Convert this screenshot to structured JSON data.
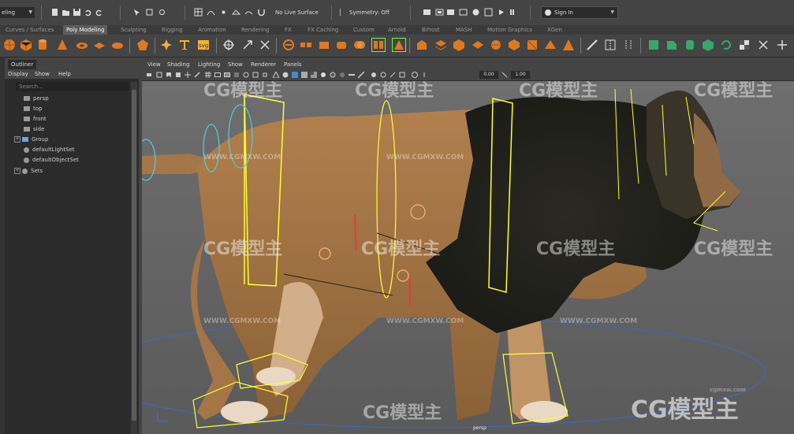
{
  "status_line": {
    "mode_menu": "eling",
    "live_surface": "No Live Surface",
    "symmetry": "Symmetry: Off",
    "sign_in": "Sign In"
  },
  "shelf_tabs": [
    "Curves / Surfaces",
    "Poly Modeling",
    "Sculpting",
    "Rigging",
    "Animation",
    "Rendering",
    "FX",
    "FX Caching",
    "Custom",
    "Arnold",
    "Bifrost",
    "MASH",
    "Motion Graphics",
    "XGen"
  ],
  "active_shelf_tab": "Poly Modeling",
  "outliner": {
    "title": "Outliner",
    "menu": [
      "Display",
      "Show",
      "Help"
    ],
    "search_placeholder": "Search...",
    "items": [
      {
        "label": "persp",
        "type": "camera"
      },
      {
        "label": "top",
        "type": "camera"
      },
      {
        "label": "front",
        "type": "camera"
      },
      {
        "label": "side",
        "type": "camera"
      },
      {
        "label": "Group",
        "type": "group",
        "expandable": true
      },
      {
        "label": "defaultLightSet",
        "type": "set"
      },
      {
        "label": "defaultObjectSet",
        "type": "set"
      },
      {
        "label": "Sets",
        "type": "set",
        "expandable": true
      }
    ]
  },
  "viewport": {
    "menu": [
      "View",
      "Shading",
      "Lighting",
      "Show",
      "Renderer",
      "Panels"
    ],
    "field_a": "0.00",
    "field_b": "1.00",
    "camera_label": "persp"
  },
  "watermarks": {
    "brand": "CG模型主",
    "url": "WWW.CGMXW.COM",
    "corner_url": "cgmxw.com"
  },
  "colors": {
    "panel_bg": "#444444",
    "dark_bg": "#2b2b2b",
    "viewport_bg": "#6a6a6a",
    "accent_tab": "#5d5d5d",
    "rig_yellow": "#ffff33",
    "rig_cyan": "#55ccdd"
  }
}
